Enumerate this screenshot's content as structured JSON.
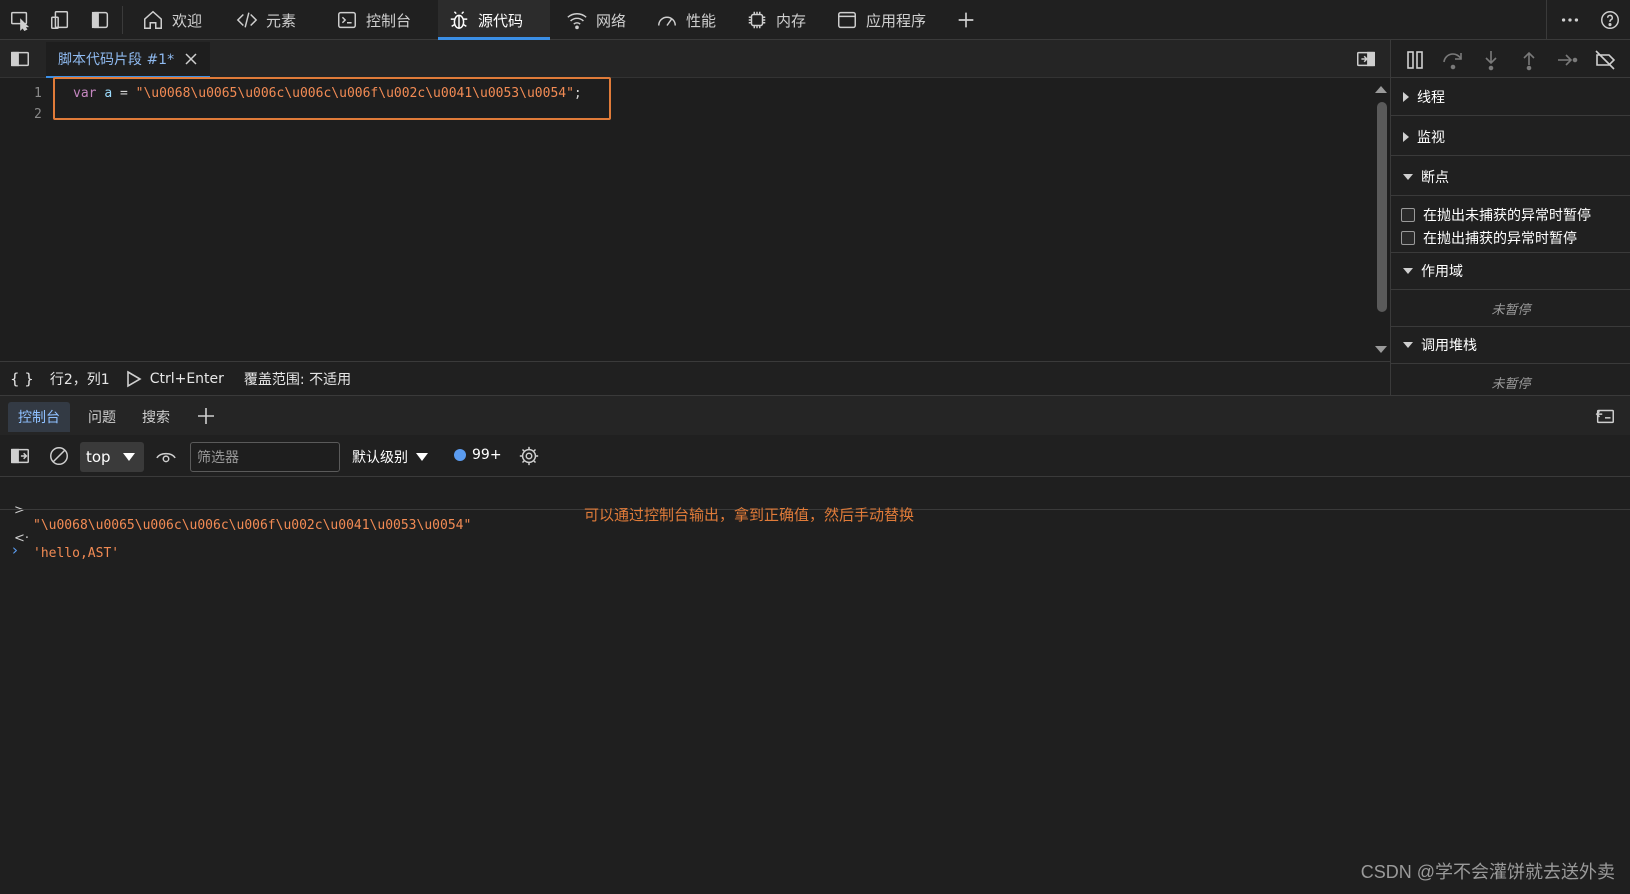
{
  "topbar": {
    "tabs": [
      {
        "label": "欢迎",
        "icon": "home-icon"
      },
      {
        "label": "元素",
        "icon": "code-icon"
      },
      {
        "label": "控制台",
        "icon": "terminal-icon"
      },
      {
        "label": "源代码",
        "icon": "bug-icon",
        "active": true
      },
      {
        "label": "网络",
        "icon": "wifi-icon"
      },
      {
        "label": "性能",
        "icon": "gauge-icon"
      },
      {
        "label": "内存",
        "icon": "chip-icon"
      },
      {
        "label": "应用程序",
        "icon": "window-icon"
      }
    ],
    "accent": "#3b8fe6"
  },
  "editor": {
    "file_tab": "脚本代码片段 #1*",
    "line_numbers": [
      "1",
      "2"
    ],
    "code": {
      "keyword": "var",
      "identifier": "a",
      "operator": "=",
      "string": "\"\\u0068\\u0065\\u006c\\u006c\\u006f\\u002c\\u0041\\u0053\\u0054\"",
      "semicolon": ";"
    },
    "highlight_color": "#e07b39"
  },
  "status": {
    "braces": "{ }",
    "position": "行2，列1",
    "run_shortcut": "Ctrl+Enter",
    "coverage": "覆盖范围: 不适用"
  },
  "debugger": {
    "sections": [
      {
        "label": "线程",
        "expanded": false
      },
      {
        "label": "监视",
        "expanded": false
      },
      {
        "label": "断点",
        "expanded": true
      },
      {
        "label": "作用域",
        "expanded": true
      },
      {
        "label": "调用堆栈",
        "expanded": true
      }
    ],
    "checkboxes": [
      "在抛出未捕获的异常时暂停",
      "在抛出捕获的异常时暂停"
    ],
    "not_paused": "未暂停"
  },
  "drawer": {
    "tabs": [
      "控制台",
      "问题",
      "搜索"
    ]
  },
  "console_toolbar": {
    "context": "top",
    "filter_placeholder": "筛选器",
    "levels": "默认级别",
    "message_count": "99+"
  },
  "console": {
    "input_line": "\"\\u0068\\u0065\\u006c\\u006c\\u006f\\u002c\\u0041\\u0053\\u0054\"",
    "output_line": "'hello,AST'",
    "annotation": "可以通过控制台输出，拿到正确值，然后手动替换"
  },
  "watermark": "CSDN @学不会灌饼就去送外卖"
}
